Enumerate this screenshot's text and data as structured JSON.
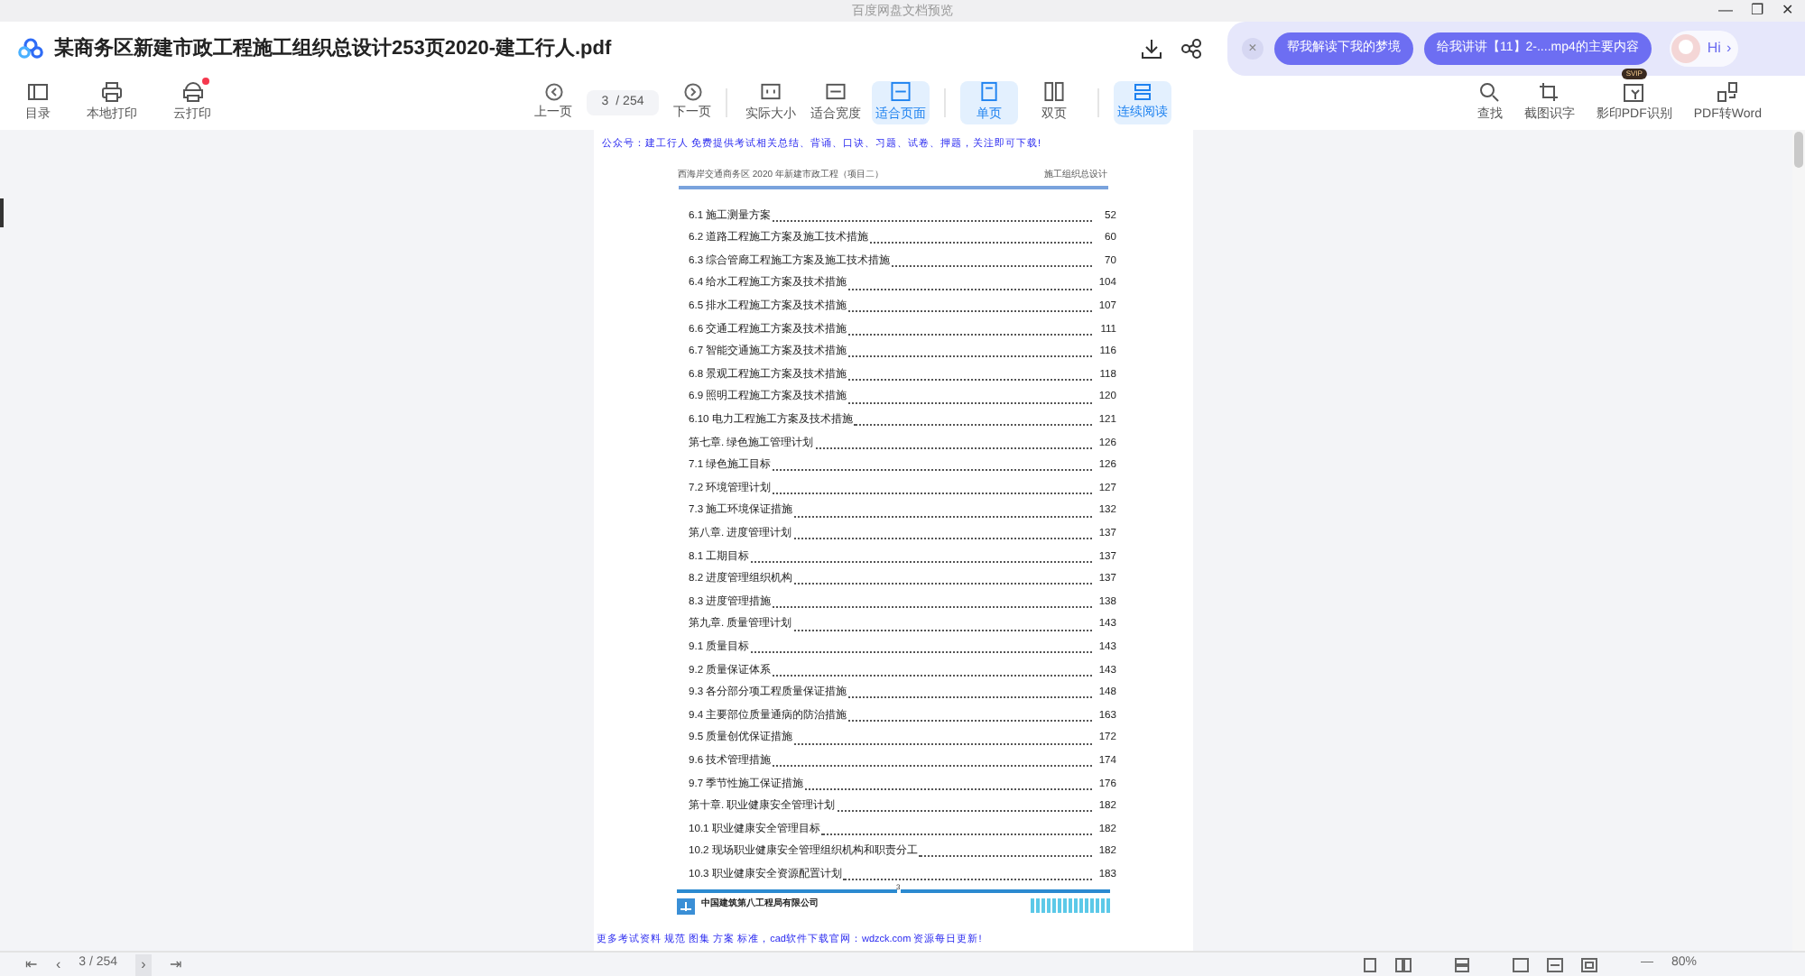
{
  "window": {
    "title": "百度网盘文档预览",
    "controls": [
      "—",
      "❐",
      "✕"
    ]
  },
  "header": {
    "file_title": "某商务区新建市政工程施工组织总设计253页2020-建工行人.pdf",
    "ai_close": "×",
    "ai_prompts": [
      "帮我解读下我的梦境",
      "给我讲讲【11】2-....mp4的主要内容"
    ],
    "assistant_greeting": "Hi",
    "assistant_arrow": "›"
  },
  "toolbar": {
    "left": [
      {
        "label": "目录",
        "dot": false
      },
      {
        "label": "本地打印",
        "dot": false
      },
      {
        "label": "云打印",
        "dot": true
      }
    ],
    "prev": "上一页",
    "page_input": "3",
    "page_total": "/ 254",
    "next": "下一页",
    "views": [
      {
        "label": "实际大小",
        "selected": false
      },
      {
        "label": "适合宽度",
        "selected": false
      },
      {
        "label": "适合页面",
        "selected": true
      }
    ],
    "layouts": [
      {
        "label": "单页",
        "selected": true
      },
      {
        "label": "双页",
        "selected": false
      }
    ],
    "scroll": {
      "label": "连续阅读",
      "selected": true
    },
    "right": [
      {
        "label": "查找"
      },
      {
        "label": "截图识字"
      },
      {
        "label": "影印PDF识别",
        "badge": "SVIP"
      },
      {
        "label": "PDF转Word"
      }
    ]
  },
  "document": {
    "top_notice": "公众号：建工行人 免费提供考试相关总结、背诵、口诀、习题、试卷、押题，关注即可下载!",
    "header_left": "西海岸交通商务区 2020 年新建市政工程（项目二）",
    "header_right": "施工组织总设计",
    "toc": [
      {
        "title": "6.1 施工测量方案",
        "page": "52"
      },
      {
        "title": "6.2 道路工程施工方案及施工技术措施",
        "page": "60"
      },
      {
        "title": "6.3 综合管廊工程施工方案及施工技术措施",
        "page": "70"
      },
      {
        "title": "6.4 给水工程施工方案及技术措施",
        "page": "104"
      },
      {
        "title": "6.5 排水工程施工方案及技术措施",
        "page": "107"
      },
      {
        "title": "6.6 交通工程施工方案及技术措施",
        "page": "111"
      },
      {
        "title": "6.7 智能交通施工方案及技术措施",
        "page": "116"
      },
      {
        "title": "6.8 景观工程施工方案及技术措施",
        "page": "118"
      },
      {
        "title": "6.9 照明工程施工方案及技术措施",
        "page": "120"
      },
      {
        "title": "6.10 电力工程施工方案及技术措施",
        "page": "121"
      },
      {
        "title": "第七章. 绿色施工管理计划",
        "page": "126"
      },
      {
        "title": "7.1 绿色施工目标",
        "page": "126"
      },
      {
        "title": "7.2 环境管理计划",
        "page": "127"
      },
      {
        "title": "7.3 施工环境保证措施",
        "page": "132"
      },
      {
        "title": "第八章. 进度管理计划",
        "page": "137"
      },
      {
        "title": "8.1 工期目标",
        "page": "137"
      },
      {
        "title": "8.2 进度管理组织机构",
        "page": "137"
      },
      {
        "title": "8.3 进度管理措施",
        "page": "138"
      },
      {
        "title": "第九章. 质量管理计划",
        "page": "143"
      },
      {
        "title": "9.1 质量目标",
        "page": "143"
      },
      {
        "title": "9.2 质量保证体系",
        "page": "143"
      },
      {
        "title": "9.3 各分部分项工程质量保证措施",
        "page": "148"
      },
      {
        "title": "9.4 主要部位质量通病的防治措施",
        "page": "163"
      },
      {
        "title": "9.5 质量创优保证措施",
        "page": "172"
      },
      {
        "title": "9.6 技术管理措施",
        "page": "174"
      },
      {
        "title": "9.7 季节性施工保证措施",
        "page": "176"
      },
      {
        "title": "第十章. 职业健康安全管理计划",
        "page": "182"
      },
      {
        "title": "10.1 职业健康安全管理目标",
        "page": "182"
      },
      {
        "title": "10.2 现场职业健康安全管理组织机构和职责分工",
        "page": "182"
      },
      {
        "title": "10.3 职业健康安全资源配置计划",
        "page": "183"
      }
    ],
    "page_number": "3",
    "company": "中国建筑第八工程局有限公司",
    "bottom_notice": "更多考试资料 规范 图集 方案 标准，cad软件下载官网：wdzck.com 资源每日更新!"
  },
  "status_bar": {
    "first": "⇤",
    "prev": "‹",
    "page": "3 / 254",
    "next": "›",
    "last": "⇥",
    "zoom_out": "—",
    "zoom": "80%"
  }
}
